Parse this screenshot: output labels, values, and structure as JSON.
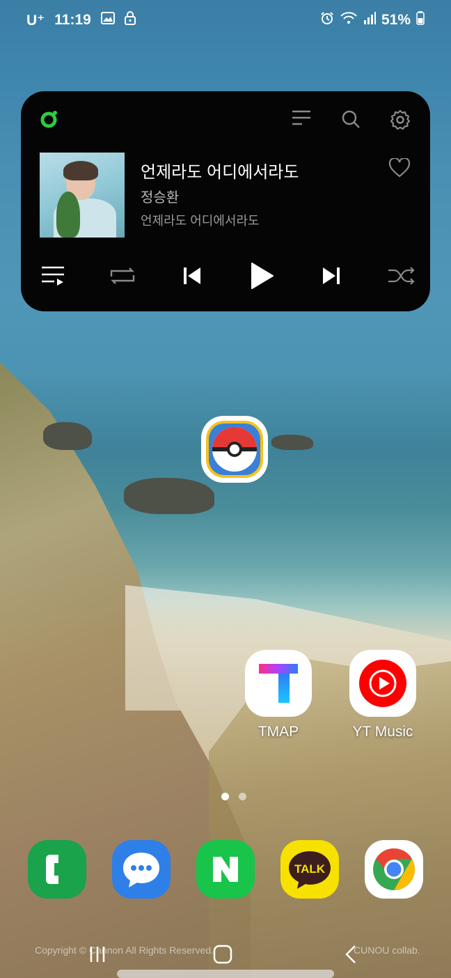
{
  "status_bar": {
    "carrier": "U⁺",
    "time": "11:19",
    "battery": "51%",
    "icons": [
      "gallery-icon",
      "lock-icon",
      "alarm-icon",
      "wifi-icon",
      "signal-icon",
      "battery-icon"
    ]
  },
  "music_widget": {
    "song_title": "언제라도 어디에서라도",
    "artist": "정승환",
    "album": "언제라도 어디에서라도",
    "accent_color": "#2ecc40",
    "top_icons": [
      "menu-icon",
      "search-icon",
      "settings-icon"
    ],
    "controls": [
      "playlist-icon",
      "repeat-icon",
      "previous-icon",
      "play-icon",
      "next-icon",
      "shuffle-icon"
    ]
  },
  "home_apps": [
    {
      "label": "",
      "icon": "pokemon-go-icon"
    },
    {
      "label": "TMAP",
      "icon": "tmap-icon"
    },
    {
      "label": "YT Music",
      "icon": "yt-music-icon"
    }
  ],
  "dock": [
    {
      "icon": "phone-icon",
      "color": "#1aa34a"
    },
    {
      "icon": "messages-icon",
      "color": "#2f7fe8"
    },
    {
      "icon": "naver-icon",
      "color": "#19c44a"
    },
    {
      "icon": "kakaotalk-icon",
      "color": "#f7e100",
      "text": "TALK"
    },
    {
      "icon": "chrome-icon",
      "color": "#ffffff"
    }
  ],
  "page_indicator": {
    "current": 1,
    "total": 2
  },
  "watermark": {
    "left": "Copyright © Cannon All Rights Reserved.",
    "right": "CUNOU collab."
  }
}
